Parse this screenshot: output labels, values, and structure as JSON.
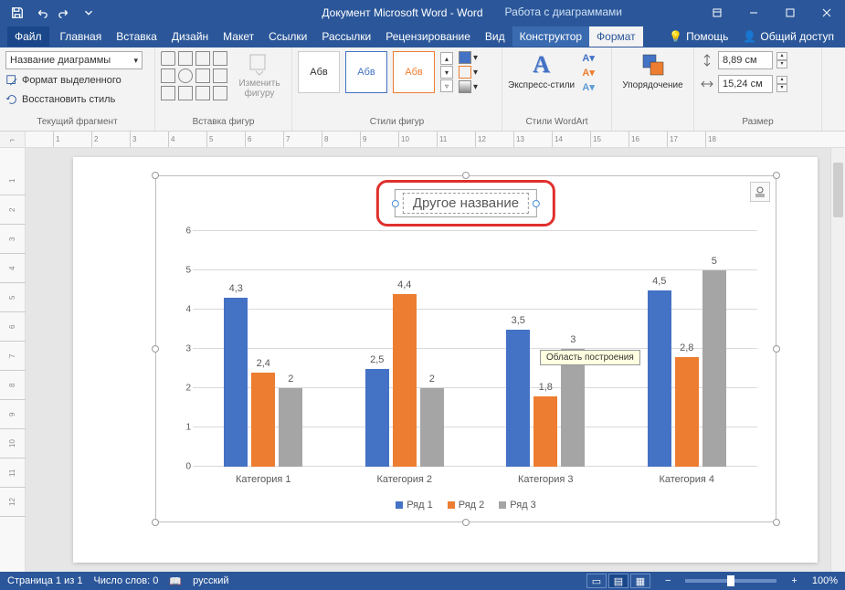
{
  "titlebar": {
    "document_title": "Документ Microsoft Word - Word",
    "context_title": "Работа с диаграммами"
  },
  "tabs": {
    "file": "Файл",
    "home": "Главная",
    "insert": "Вставка",
    "design": "Дизайн",
    "layout": "Макет",
    "references": "Ссылки",
    "mailings": "Рассылки",
    "review": "Рецензирование",
    "view": "Вид",
    "constructor": "Конструктор",
    "format": "Формат",
    "help": "Помощь",
    "share": "Общий доступ"
  },
  "ribbon": {
    "current_selection": {
      "combo": "Название диаграммы",
      "format_sel": "Формат выделенного",
      "reset_style": "Восстановить стиль",
      "group": "Текущий фрагмент"
    },
    "insert_shapes": {
      "change_shape": "Изменить фигуру",
      "group": "Вставка фигур"
    },
    "shape_styles": {
      "sample": "Абв",
      "group": "Стили фигур"
    },
    "wordart": {
      "express": "Экспресс-стили",
      "group": "Стили WordArt"
    },
    "arrange": {
      "label": "Упорядочение"
    },
    "size": {
      "height": "8,89 см",
      "width": "15,24 см",
      "group": "Размер"
    }
  },
  "chart_data": {
    "type": "bar",
    "title": "Другое название",
    "categories": [
      "Категория 1",
      "Категория 2",
      "Категория 3",
      "Категория 4"
    ],
    "series": [
      {
        "name": "Ряд 1",
        "color": "#4472c4",
        "values": [
          4.3,
          2.5,
          3.5,
          4.5
        ]
      },
      {
        "name": "Ряд 2",
        "color": "#ed7d31",
        "values": [
          2.4,
          4.4,
          1.8,
          2.8
        ]
      },
      {
        "name": "Ряд 3",
        "color": "#a5a5a5",
        "values": [
          2,
          2,
          3,
          5
        ]
      }
    ],
    "ylim": [
      0,
      6
    ],
    "yticks": [
      0,
      1,
      2,
      3,
      4,
      5,
      6
    ],
    "tooltip": "Область построения"
  },
  "status": {
    "page": "Страница 1 из 1",
    "words": "Число слов: 0",
    "lang": "русский",
    "zoom": "100%"
  },
  "hruler_end": 18
}
